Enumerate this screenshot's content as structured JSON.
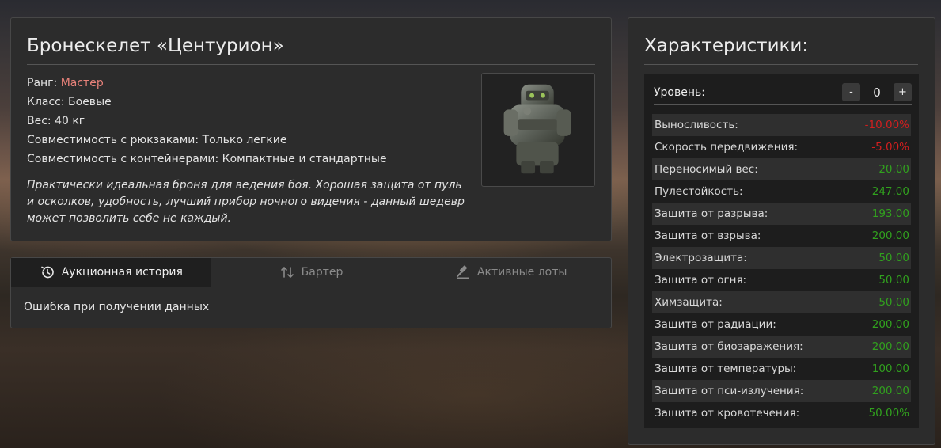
{
  "item": {
    "title": "Бронескелет «Центурион»",
    "rank_label": "Ранг: ",
    "rank_value": "Мастер",
    "class_line": "Класс: Боевые",
    "weight_line": "Вес: 40 кг",
    "backpacks_line": "Совместимость с рюкзаками: Только легкие",
    "containers_line": "Совместимость с контейнерами: Компактные и стандартные",
    "description": "Практически идеальная броня для ведения боя. Хорошая защита от пуль и осколков, удобность, лучший прибор ночного видения - данный шедевр может позволить себе не каждый."
  },
  "tabs": [
    {
      "label": "Аукционная история",
      "icon": "history-icon",
      "active": true
    },
    {
      "label": "Бартер",
      "icon": "swap-vertical-icon",
      "active": false
    },
    {
      "label": "Активные лоты",
      "icon": "gavel-icon",
      "active": false
    }
  ],
  "tab_content": {
    "error": "Ошибка при получении данных"
  },
  "stats": {
    "title": "Характеристики:",
    "level_label": "Уровень:",
    "level_minus": "-",
    "level_value": "0",
    "level_plus": "+",
    "rows": [
      {
        "name": "Выносливость:",
        "value": "-10.00%",
        "sign": "neg"
      },
      {
        "name": "Скорость передвижения:",
        "value": "-5.00%",
        "sign": "neg"
      },
      {
        "name": "Переносимый вес:",
        "value": "20.00",
        "sign": "pos"
      },
      {
        "name": "Пулестойкость:",
        "value": "247.00",
        "sign": "pos"
      },
      {
        "name": "Защита от разрыва:",
        "value": "193.00",
        "sign": "pos"
      },
      {
        "name": "Защита от взрыва:",
        "value": "200.00",
        "sign": "pos"
      },
      {
        "name": "Электрозащита:",
        "value": "50.00",
        "sign": "pos"
      },
      {
        "name": "Защита от огня:",
        "value": "50.00",
        "sign": "pos"
      },
      {
        "name": "Химзащита:",
        "value": "50.00",
        "sign": "pos"
      },
      {
        "name": "Защита от радиации:",
        "value": "200.00",
        "sign": "pos"
      },
      {
        "name": "Защита от биозаражения:",
        "value": "200.00",
        "sign": "pos"
      },
      {
        "name": "Защита от температуры:",
        "value": "100.00",
        "sign": "pos"
      },
      {
        "name": "Защита от пси-излучения:",
        "value": "200.00",
        "sign": "pos"
      },
      {
        "name": "Защита от кровотечения:",
        "value": "50.00%",
        "sign": "pos"
      }
    ]
  },
  "colors": {
    "rank": "#e9827a",
    "negative": "#d11f1f",
    "positive": "#31a11e"
  }
}
